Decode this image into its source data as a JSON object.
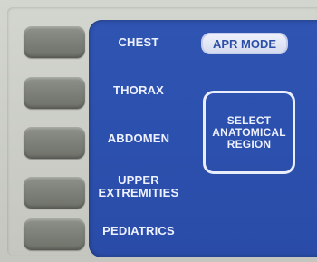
{
  "menu": {
    "items": [
      {
        "label": "CHEST"
      },
      {
        "label": "THORAX"
      },
      {
        "label": "ABDOMEN"
      },
      {
        "label": "UPPER\nEXTREMITIES"
      },
      {
        "label": "PEDIATRICS"
      }
    ]
  },
  "mode_button": {
    "label": "APR MODE"
  },
  "prompt": {
    "text": "SELECT\nANATOMICAL\nREGION"
  },
  "colors": {
    "screen": "#2c50ae",
    "bezel": "#c9cbc4",
    "soft_key": "#7b7e76",
    "text": "#eef1ff"
  }
}
